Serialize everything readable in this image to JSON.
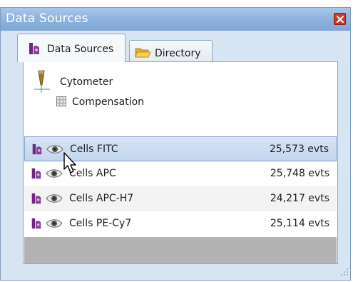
{
  "window": {
    "title": "Data Sources"
  },
  "tabs": [
    {
      "label": "Data Sources",
      "icon": "flask-icon",
      "active": true
    },
    {
      "label": "Directory",
      "icon": "folder-icon",
      "active": false
    }
  ],
  "tree": {
    "instrument": {
      "label": "Cytometer",
      "icon": "cytometer-icon"
    },
    "compensation": {
      "label": "Compensation",
      "icon": "grid-icon"
    }
  },
  "rows": [
    {
      "name": "Cells FITC",
      "events": "25,573 evts",
      "selected": true
    },
    {
      "name": "Cells APC",
      "events": "25,748 evts",
      "selected": false
    },
    {
      "name": "Cells APC-H7",
      "events": "24,217 evts",
      "selected": false
    },
    {
      "name": "Cells PE-Cy7",
      "events": "25,114 evts",
      "selected": false
    }
  ],
  "colors": {
    "titlebar": "#8fb3dd",
    "selection": "#c3d6ee",
    "close": "#c43b2e",
    "flask": "#7a2d86",
    "footer": "#b3b3b3"
  }
}
